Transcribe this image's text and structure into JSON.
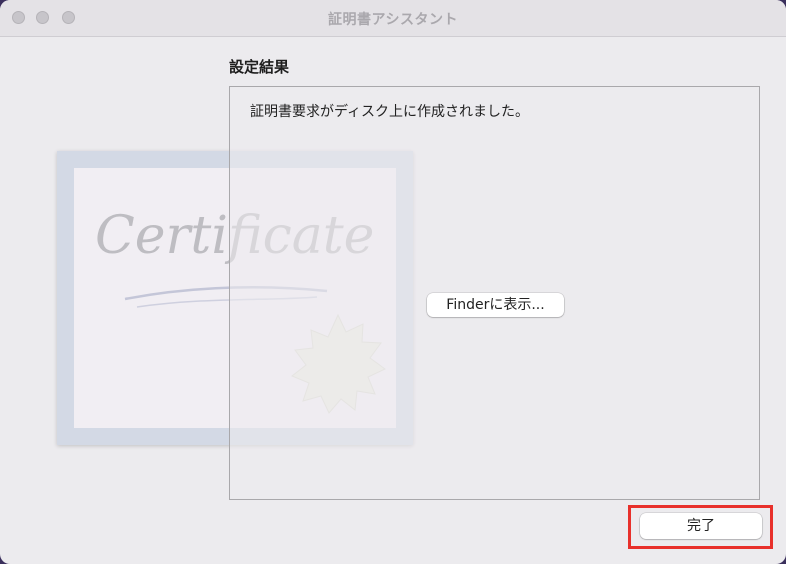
{
  "window": {
    "title": "証明書アシスタント"
  },
  "illustration": {
    "script_text": "Certificate"
  },
  "result": {
    "heading": "設定結果",
    "message": "証明書要求がディスク上に作成されました。",
    "show_in_finder_label": "Finderに表示..."
  },
  "footer": {
    "done_label": "完了"
  },
  "colors": {
    "highlight": "#e8302b",
    "window_background": "#ecebee",
    "certificate_frame": "#d3d9e5"
  }
}
